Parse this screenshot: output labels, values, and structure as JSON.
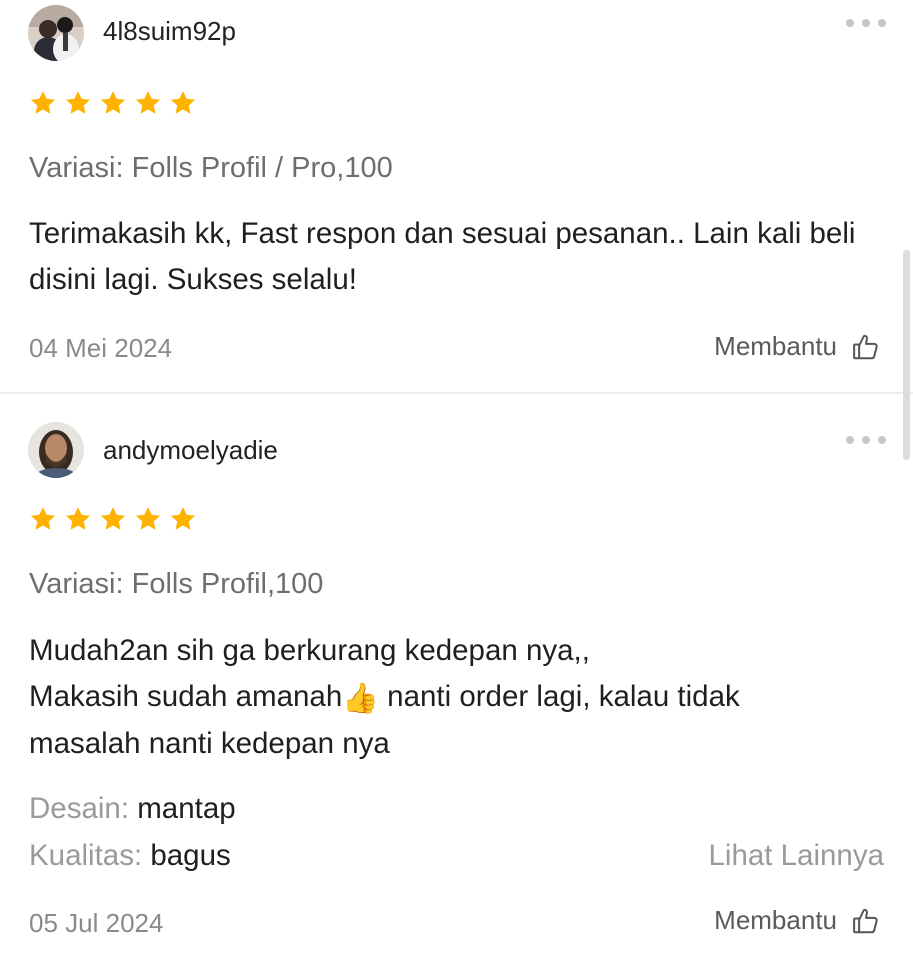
{
  "colors": {
    "star": "#FFB300",
    "divider": "#EEEEEE",
    "muted_text": "#8A8A8A",
    "body_text": "#1F1F1F"
  },
  "icons": {
    "rating": "star-icon",
    "more": "more-dots-icon",
    "helpful": "thumbs-up-outline-icon"
  },
  "reviews": [
    {
      "username": "4l8suim92p",
      "rating": 5,
      "variation": "Variasi: Folls Profil / Pro,100",
      "comment": "Terimakasih kk, Fast respon dan sesuai pesanan.. Lain kali beli disini lagi. Sukses selalu!",
      "date": "04 Mei 2024",
      "helpful_label": "Membantu"
    },
    {
      "username": "andymoelyadie",
      "rating": 5,
      "variation": "Variasi: Folls Profil,100",
      "comment_lines": [
        "Mudah2an sih ga berkurang kedepan nya,,",
        "Makasih sudah amanah",
        "👍",
        " nanti order lagi, kalau tidak",
        "masalah nanti kedepan nya"
      ],
      "attributes": [
        {
          "label": "Desain:",
          "value": "mantap"
        },
        {
          "label": "Kualitas:",
          "value": "bagus"
        }
      ],
      "see_more": "Lihat Lainnya",
      "date": "05 Jul 2024",
      "helpful_label": "Membantu"
    }
  ]
}
